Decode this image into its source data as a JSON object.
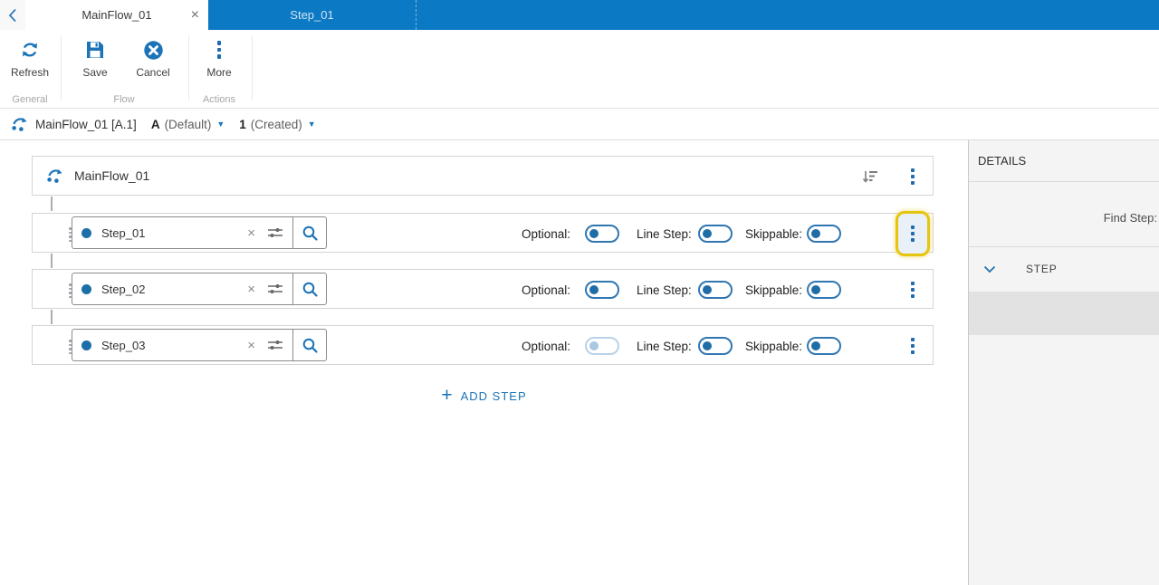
{
  "tabs": {
    "active": {
      "label": "MainFlow_01",
      "close_glyph": "×"
    },
    "inactive": {
      "label": "Step_01"
    }
  },
  "toolbar": {
    "groups": [
      {
        "label": "General",
        "buttons": [
          {
            "label": "Refresh",
            "icon": "refresh-icon"
          }
        ]
      },
      {
        "label": "Flow",
        "buttons": [
          {
            "label": "Save",
            "icon": "save-icon"
          },
          {
            "label": "Cancel",
            "icon": "cancel-icon"
          }
        ]
      },
      {
        "label": "Actions",
        "buttons": [
          {
            "label": "More",
            "icon": "kebab-icon"
          }
        ]
      }
    ]
  },
  "breadcrumb": {
    "icon": "flow-icon",
    "title": "MainFlow_01 [A.1]",
    "version": {
      "value": "A",
      "status": "(Default)",
      "caret": "▼"
    },
    "revision": {
      "value": "1",
      "status": "(Created)",
      "caret": "▼"
    }
  },
  "flow_editor": {
    "header": {
      "icon": "flow-icon",
      "title": "MainFlow_01",
      "sort_icon": "sort-descending-icon",
      "menu_icon": "kebab-icon"
    },
    "toggle_labels": {
      "optional": "Optional:",
      "line_step": "Line Step:",
      "skippable": "Skippable:"
    },
    "clear_glyph": "×",
    "steps": [
      {
        "index": "1",
        "name": "Step_01",
        "optional": "off",
        "line_step": "off",
        "skippable": "off",
        "optional_disabled": false,
        "menu_highlighted": true
      },
      {
        "index": "2",
        "name": "Step_02",
        "optional": "off",
        "line_step": "off",
        "skippable": "off",
        "optional_disabled": false,
        "menu_highlighted": false
      },
      {
        "index": "3",
        "name": "Step_03",
        "optional": "off",
        "line_step": "off",
        "skippable": "off",
        "optional_disabled": true,
        "menu_highlighted": false
      }
    ],
    "add_step": {
      "plus_glyph": "+",
      "label": "ADD STEP"
    }
  },
  "details_panel": {
    "title": "DETAILS",
    "find_step_label": "Find Step:",
    "sections": [
      {
        "label": "STEP",
        "expanded": true
      }
    ]
  },
  "colors": {
    "accent_blue": "#1b74b8",
    "tab_bar_blue": "#0b79c3",
    "highlight_yellow": "#e6c50e",
    "panel_gray": "#f4f4f4"
  }
}
